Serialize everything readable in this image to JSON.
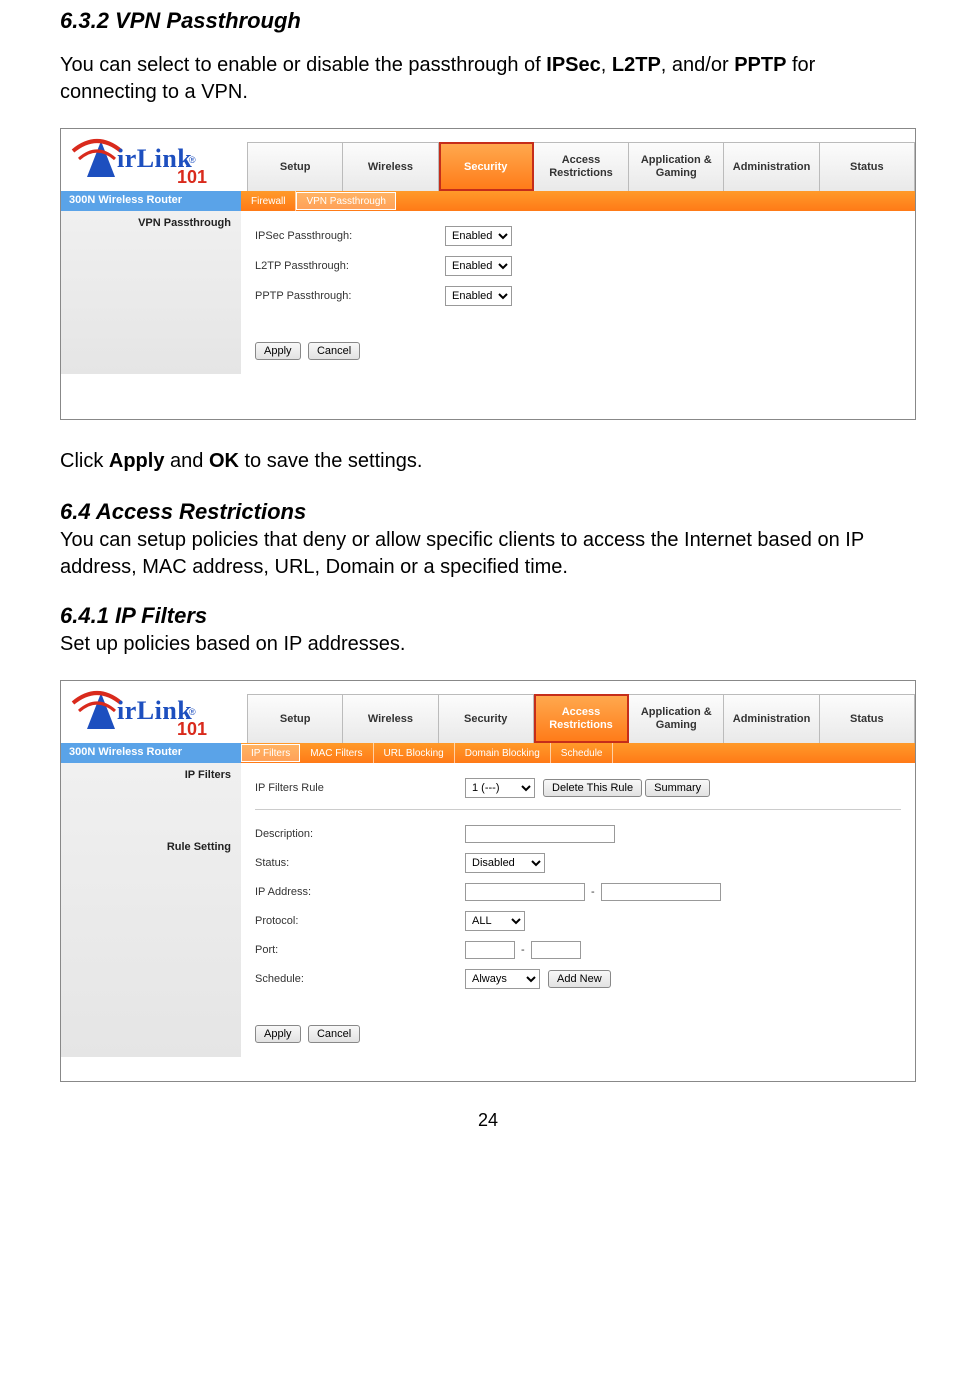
{
  "doc": {
    "h632": "6.3.2 VPN Passthrough",
    "p632": "You can select to enable or disable the passthrough of ",
    "p632_b1": "IPSec",
    "p632_m1": ", ",
    "p632_b2": "L2TP",
    "p632_m2": ", and/or ",
    "p632_b3": "PPTP",
    "p632_m3": " for connecting to a VPN.",
    "p_click_1": "Click ",
    "p_click_b1": "Apply",
    "p_click_2": " and ",
    "p_click_b2": "OK",
    "p_click_3": " to save the settings.",
    "h64": "6.4 Access Restrictions",
    "p64": "You can setup policies that deny or allow specific clients to access the Internet based on IP address, MAC address, URL, Domain or a specified time.",
    "h641": "6.4.1 IP Filters",
    "p641": "Set up policies based on IP addresses.",
    "page_num": "24"
  },
  "shared": {
    "model": "300N Wireless Router",
    "logo_text": "irLink",
    "logo_sub": "101",
    "tabs": {
      "setup": "Setup",
      "wireless": "Wireless",
      "security": "Security",
      "access": "Access Restrictions",
      "app": "Application & Gaming",
      "admin": "Administration",
      "status": "Status"
    },
    "apply": "Apply",
    "cancel": "Cancel"
  },
  "shot1": {
    "sublinks": {
      "firewall": "Firewall",
      "vpn": "VPN Passthrough"
    },
    "section": "VPN Passthrough",
    "rows": {
      "ipsec_lbl": "IPSec Passthrough:",
      "l2tp_lbl": "L2TP Passthrough:",
      "pptp_lbl": "PPTP Passthrough:",
      "enabled": "Enabled"
    }
  },
  "shot2": {
    "sublinks": {
      "ip": "IP Filters",
      "mac": "MAC Filters",
      "url": "URL Blocking",
      "domain": "Domain Blocking",
      "sched": "Schedule"
    },
    "sections": {
      "ipfilters": "IP Filters",
      "rulesetting": "Rule Setting"
    },
    "rows": {
      "rule_lbl": "IP Filters Rule",
      "rule_val": "1 (---)",
      "delete_btn": "Delete This Rule",
      "summary_btn": "Summary",
      "desc_lbl": "Description:",
      "status_lbl": "Status:",
      "status_val": "Disabled",
      "ip_lbl": "IP Address:",
      "proto_lbl": "Protocol:",
      "proto_val": "ALL",
      "port_lbl": "Port:",
      "sched_lbl": "Schedule:",
      "sched_val": "Always",
      "addnew_btn": "Add New"
    }
  }
}
